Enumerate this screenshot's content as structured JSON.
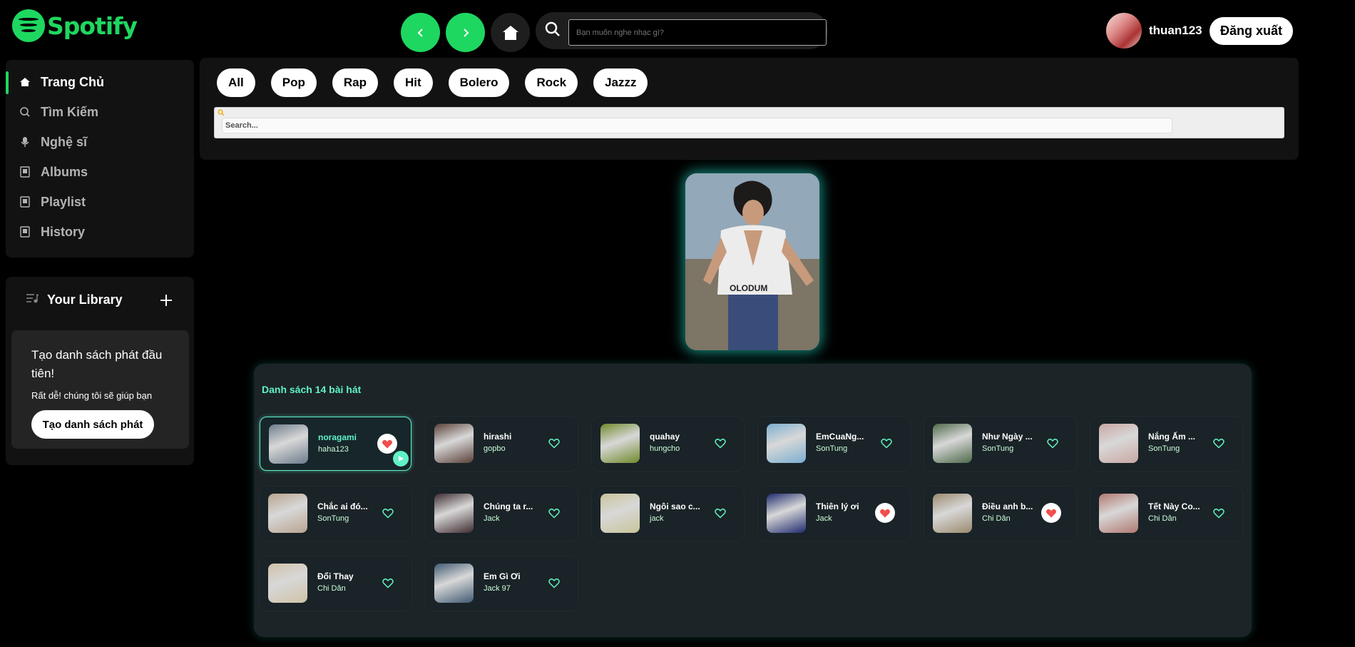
{
  "brand": {
    "name": "Spotify"
  },
  "header": {
    "search_placeholder": "Bạn muốn nghe nhạc gì?",
    "username": "thuan123",
    "logout_label": "Đăng xuất"
  },
  "sidebar": {
    "items": [
      {
        "label": "Trang Chủ",
        "icon": "home-icon",
        "active": true
      },
      {
        "label": "Tìm Kiếm",
        "icon": "search-icon"
      },
      {
        "label": "Nghệ sĩ",
        "icon": "microphone-icon"
      },
      {
        "label": "Albums",
        "icon": "album-icon"
      },
      {
        "label": "Playlist",
        "icon": "playlist-icon"
      },
      {
        "label": "History",
        "icon": "history-icon"
      }
    ]
  },
  "library": {
    "title": "Your Library",
    "card_title": "Tạo danh sách phát đầu tiên!",
    "card_sub": "Rất dễ! chúng tôi sẽ giúp bạn",
    "create_label": "Tạo danh sách phát"
  },
  "genres": [
    "All",
    "Pop",
    "Rap",
    "Hit",
    "Bolero",
    "Rock",
    "Jazzz"
  ],
  "filter": {
    "placeholder": "Search..."
  },
  "songs": {
    "title": "Danh sách 14 bài hát",
    "items": [
      {
        "title": "noragami",
        "artist": "haha123",
        "liked": true,
        "playing": true,
        "thumb": "#6d7c8c"
      },
      {
        "title": "hirashi",
        "artist": "gopbo",
        "liked": false,
        "thumb": "#5a4038"
      },
      {
        "title": "quahay",
        "artist": "hungcho",
        "liked": false,
        "thumb": "#6f8a2a"
      },
      {
        "title": "EmCuaNg...",
        "artist": "SonTung",
        "liked": false,
        "thumb": "#7aaed0"
      },
      {
        "title": "Như Ngày ...",
        "artist": "SonTung",
        "liked": false,
        "thumb": "#4e6a4a"
      },
      {
        "title": "Nắng Ấm ...",
        "artist": "SonTung",
        "liked": false,
        "thumb": "#c9a7a3"
      },
      {
        "title": "Chắc ai đó...",
        "artist": "SonTung",
        "liked": false,
        "thumb": "#b8a48f"
      },
      {
        "title": "Chúng ta r...",
        "artist": "Jack",
        "liked": false,
        "thumb": "#3d2b30"
      },
      {
        "title": "Ngôi sao c...",
        "artist": "jack",
        "liked": false,
        "thumb": "#c9c49a"
      },
      {
        "title": "Thiên lý ơi",
        "artist": "Jack",
        "liked": true,
        "thumb": "#1f2a6e"
      },
      {
        "title": "Điều anh b...",
        "artist": "Chi Dân",
        "liked": true,
        "thumb": "#9a8a6e"
      },
      {
        "title": "Tết Này Co...",
        "artist": "Chi Dân",
        "liked": false,
        "thumb": "#b07870"
      },
      {
        "title": "Đổi Thay",
        "artist": "Chi Dân",
        "liked": false,
        "thumb": "#cfc2a8"
      },
      {
        "title": "Em Gì Ơi",
        "artist": "Jack 97",
        "liked": false,
        "thumb": "#3f5a72"
      }
    ]
  },
  "colors": {
    "accent": "#1ed760",
    "teal": "#5ff2c6",
    "like": "#f24e4e"
  }
}
